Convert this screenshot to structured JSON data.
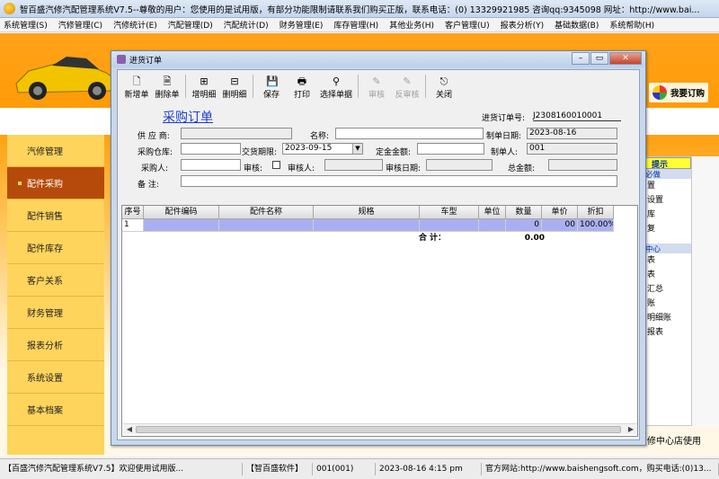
{
  "window": {
    "title": "智百盛汽修汽配管理系统V7.5--尊敬的用户：您使用的是试用版，有部分功能限制请联系我们购买正版，联系电话：(0) 13329921985  咨询qq:9345098  网址：http://www.bai..."
  },
  "menu": [
    "系统管理(S)",
    "汽修管理(C)",
    "汽修统计(E)",
    "汽配管理(D)",
    "汽配统计(D)",
    "财务管理(E)",
    "库存管理(H)",
    "其他业务(H)",
    "客户管理(U)",
    "报表分析(Y)",
    "基础数据(B)",
    "系统帮助(H)"
  ],
  "my_order": "我要订购",
  "sidenav": [
    {
      "label": "汽修管理",
      "active": false
    },
    {
      "label": "配件采购",
      "active": true
    },
    {
      "label": "配件销售",
      "active": false
    },
    {
      "label": "配件库存",
      "active": false
    },
    {
      "label": "客户关系",
      "active": false
    },
    {
      "label": "财务管理",
      "active": false
    },
    {
      "label": "报表分析",
      "active": false
    },
    {
      "label": "系统设置",
      "active": false
    },
    {
      "label": "基本档案",
      "active": false
    }
  ],
  "hint": {
    "head": "提示",
    "sub1": "必做",
    "lines1": [
      "置",
      "设置",
      "库",
      "复"
    ],
    "sub2": "中心",
    "lines2": [
      "表",
      "表",
      "汇总",
      "账",
      "明细账",
      "报表"
    ],
    "footer": "修中心店使用"
  },
  "dialog": {
    "title": "进货订单",
    "toolbar": [
      {
        "label": "新增单",
        "icon": "new-doc-icon",
        "glyph": "🗋",
        "disabled": false
      },
      {
        "label": "删除单",
        "icon": "delete-doc-icon",
        "glyph": "🗎",
        "disabled": false
      },
      {
        "label": "增明细",
        "icon": "add-row-icon",
        "glyph": "⊞",
        "disabled": false
      },
      {
        "label": "删明细",
        "icon": "delete-row-icon",
        "glyph": "⊟",
        "disabled": false
      },
      {
        "label": "保存",
        "icon": "save-icon",
        "glyph": "💾",
        "disabled": false
      },
      {
        "label": "打印",
        "icon": "print-icon",
        "glyph": "🖶",
        "disabled": false
      },
      {
        "label": "选择单据",
        "icon": "binoculars-icon",
        "glyph": "⚲",
        "disabled": false
      },
      {
        "label": "审核",
        "icon": "audit-icon",
        "glyph": "✎",
        "disabled": true
      },
      {
        "label": "反审核",
        "icon": "unaudit-icon",
        "glyph": "✎",
        "disabled": true
      },
      {
        "label": "关闭",
        "icon": "close-door-icon",
        "glyph": "⎋",
        "disabled": false
      }
    ],
    "form_title": "采购订单",
    "order_no_label": "进货订单号:",
    "order_no": "J2308160010001",
    "labels": {
      "supplier": "供 应 商:",
      "name": "名称:",
      "created_date": "制单日期:",
      "warehouse": "采购仓库:",
      "delivery_deadline": "交货期限:",
      "deposit": "定金金额:",
      "creator": "制单人:",
      "purchaser": "采购人:",
      "audit": "审核:",
      "auditor": "审核人:",
      "audit_date": "审核日期:",
      "total": "总金额:",
      "remark": "备    注:"
    },
    "values": {
      "created_date": "2023-08-16",
      "delivery_deadline": "2023-09-15",
      "creator": "001"
    },
    "grid": {
      "headers": [
        "序号",
        "配件编码",
        "配件名称",
        "规格",
        "车型",
        "单位",
        "数量",
        "单价",
        "折扣"
      ],
      "rows": [
        [
          "1",
          "",
          "",
          "",
          "",
          "",
          "0",
          "00",
          "100.00%"
        ]
      ],
      "total_label": "合 计：",
      "total_value": "0.00"
    }
  },
  "statusbar": [
    "【百盛汽修汽配管理系统V7.5】欢迎使用试用版...",
    "【智百盛软件】",
    "001(001)",
    "2023-08-16 4:15 pm",
    "官方网站:http://www.baishengsoft.com，购买电话:(0)13..."
  ]
}
